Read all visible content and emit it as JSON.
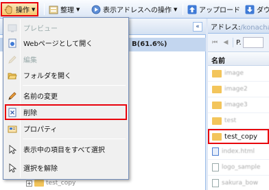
{
  "toolbar": {
    "actions_label": "操作",
    "organize_label": "整理",
    "address_actions_label": "表示アドレスへの操作",
    "upload_label": "アップロード",
    "download_label": "ダウ"
  },
  "left_panel": {
    "quota_text": "B(61.6%)",
    "collapse_glyph": "«",
    "tree_item": "test_copy"
  },
  "right_panel": {
    "address_label": "アドレス:",
    "address_value": "/konacha",
    "page_prefix": "P.",
    "name_header": "名前",
    "files": [
      {
        "name": "image",
        "type": "folder"
      },
      {
        "name": "image2",
        "type": "folder"
      },
      {
        "name": "image3",
        "type": "folder"
      },
      {
        "name": "test",
        "type": "folder"
      },
      {
        "name": "test_copy",
        "type": "folder"
      },
      {
        "name": "index.html",
        "type": "doc-blue"
      },
      {
        "name": "logo_sample",
        "type": "doc"
      },
      {
        "name": "sakura_bow",
        "type": "doc"
      }
    ]
  },
  "menu": {
    "items": [
      {
        "label": "プレビュー",
        "icon": "preview-icon",
        "disabled": true
      },
      {
        "label": "Webページとして開く",
        "icon": "web-page-icon",
        "disabled": false
      },
      {
        "label": "編集",
        "icon": "edit-icon",
        "disabled": true
      },
      {
        "label": "フォルダを開く",
        "icon": "open-folder-icon",
        "disabled": false
      },
      {
        "label": "名前の変更",
        "icon": "rename-icon",
        "disabled": false
      },
      {
        "label": "削除",
        "icon": "delete-icon",
        "disabled": false,
        "highlighted": true
      },
      {
        "label": "プロパティ",
        "icon": "properties-icon",
        "disabled": false
      },
      {
        "label": "表示中の項目をすべて選択",
        "icon": "select-all-icon",
        "disabled": false
      },
      {
        "label": "選択を解除",
        "icon": "deselect-icon",
        "disabled": false
      }
    ]
  },
  "colors": {
    "highlight_border": "#e8000b",
    "panel_border": "#99bbe8",
    "folder": "#f3c55b"
  }
}
